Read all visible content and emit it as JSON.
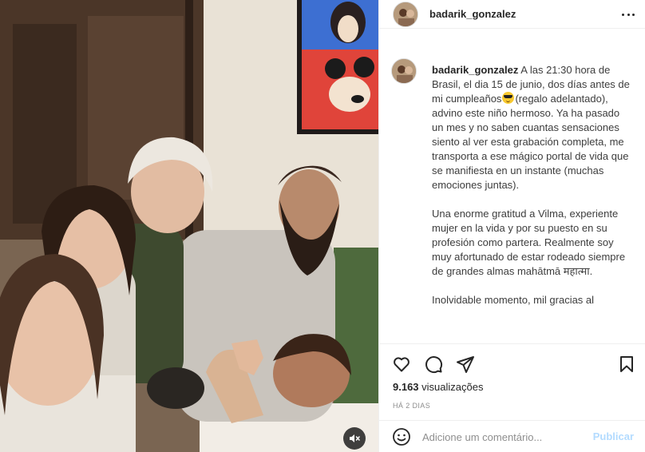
{
  "post": {
    "username": "badarik_gonzalez",
    "caption": {
      "username": "badarik_gonzalez",
      "paragraph1_before_emoji": "A las 21:30 hora de Brasil, el dia 15 de junio, dos días antes de mi cumpleaños",
      "paragraph1_emoji": "smiling-face-with-sunglasses",
      "paragraph1_after_emoji": "(regalo adelantado), advino este niño hermoso. Ya ha pasado un mes y no saben cuantas sensaciones siento al ver esta grabación completa, me transporta a ese mágico portal de vida que se manifiesta en un instante (muchas emociones juntas).",
      "paragraph2": "Una enorme gratitud a Vilma, experiente mujer en la vida y por su puesto en su profesión como partera. Realmente soy muy afortunado de estar rodeado siempre de grandes almas mahātmā महात्मा.",
      "paragraph3": "Inolvidable momento, mil gracias al"
    },
    "views_count": "9.163",
    "views_label": "visualizações",
    "time_ago": "HÁ 2 DIAS",
    "comment_placeholder": "Adicione um comentário...",
    "publish_label": "Publicar",
    "icons": {
      "more": "more-options-icon",
      "like": "heart-icon",
      "comment": "comment-bubble-icon",
      "share": "paper-plane-icon",
      "save": "bookmark-icon",
      "emoji": "smiley-icon",
      "mute": "speaker-muted-icon"
    },
    "colors": {
      "publish_disabled": "#b3dbff",
      "text_primary": "#262626",
      "text_secondary": "#8e8e8e",
      "divider": "#efefef"
    }
  }
}
